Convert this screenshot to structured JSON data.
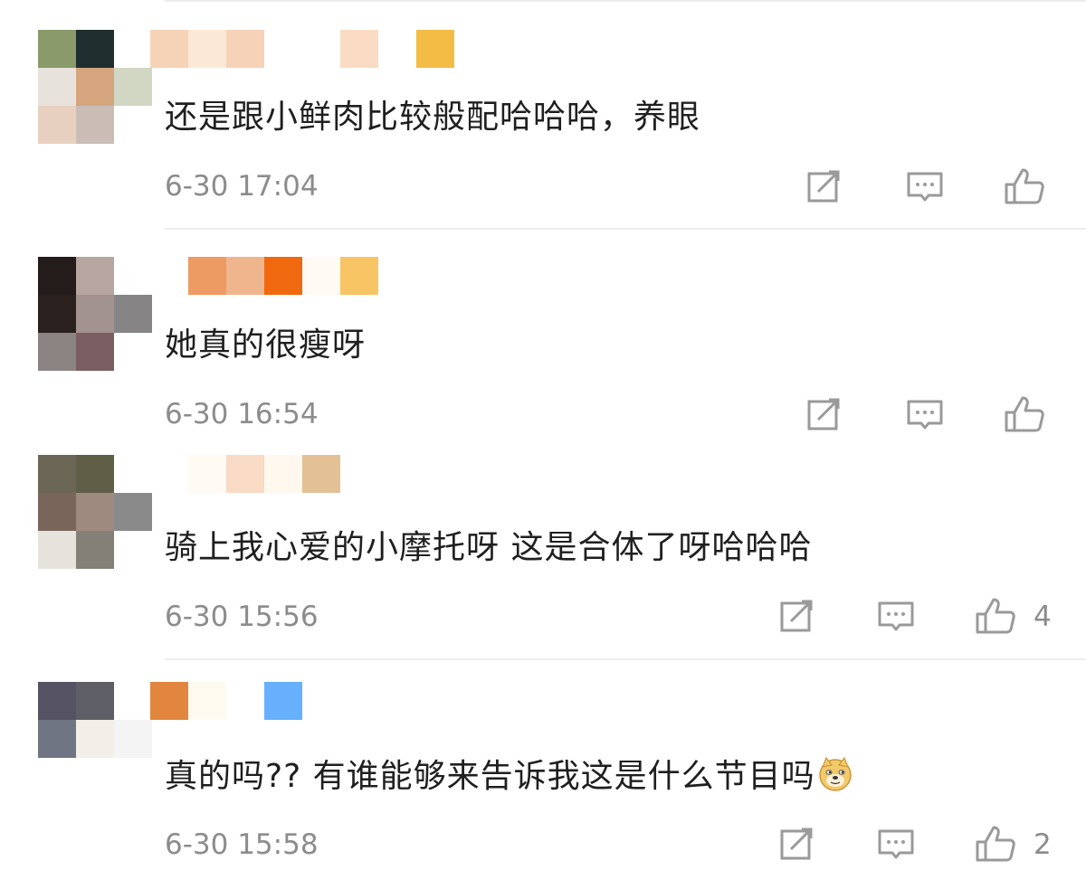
{
  "comments": [
    {
      "text": "还是跟小鲜肉比较般配哈哈哈，养眼",
      "time": "6-30 17:04",
      "likes": "",
      "has_emoji": false,
      "avatar_colors": [
        "#8a9a6a",
        "#1f2e2e",
        "#ffffff",
        "#e8e2dc",
        "#d5a57e",
        "#d2d7c3",
        "#e8d0c0",
        "#c9bdb6",
        "#ffffff"
      ],
      "name_colors": [
        "#f6d3b6",
        "#fbe8d6",
        "#f6d2b8",
        "#ffffff",
        "#ffffff",
        "#f9dcc3",
        "#ffffff",
        "#f3bc45"
      ]
    },
    {
      "text": "她真的很瘦呀",
      "time": "6-30 16:54",
      "likes": "",
      "has_emoji": false,
      "avatar_colors": [
        "#231c1b",
        "#b7a5a2",
        "#ffffff",
        "#2a211f",
        "#a29391",
        "#868485",
        "#8c8383",
        "#7a5e62",
        "#ffffff"
      ],
      "name_colors": [
        "#ffffff",
        "#ee9b63",
        "#efb58d",
        "#f0690e",
        "#fffaf4",
        "#f8c565",
        "#ffffff",
        "#ffffff"
      ]
    },
    {
      "text": "骑上我心爱的小摩托呀 这是合体了呀哈哈哈",
      "time": "6-30 15:56",
      "likes": "4",
      "has_emoji": false,
      "avatar_colors": [
        "#6c6657",
        "#5f5f48",
        "#ffffff",
        "#79655a",
        "#9f8a80",
        "#8a8a8a",
        "#e6e3dc",
        "#858077",
        "#ffffff"
      ],
      "name_colors": [
        "#ffffff",
        "#fffaf3",
        "#f9dac5",
        "#fff8ee",
        "#e3c194",
        "#ffffff",
        "#ffffff",
        "#ffffff"
      ]
    },
    {
      "text": "真的吗?? 有谁能够来告诉我这是什么节目吗",
      "time": "6-30 15:58",
      "likes": "2",
      "has_emoji": true,
      "avatar_colors": [
        "#555363",
        "#5e5e66",
        "#ffffff",
        "#6f7582",
        "#f2efe8",
        "#f4f4f4",
        "#ffffff",
        "#ffffff",
        "#ffffff"
      ],
      "name_colors": [
        "#e2863f",
        "#fffaf0",
        "#ffffff",
        "#66b0fd",
        "#ffffff",
        "#ffffff",
        "#ffffff",
        "#ffffff"
      ]
    }
  ],
  "icons": {
    "share": "share-icon",
    "reply": "comment-icon",
    "like": "thumbs-up-icon",
    "emoji": "doge-emoji-icon"
  },
  "colors": {
    "text": "#1f1f1f",
    "meta": "#8c8c8c",
    "icon": "#9a9a9a",
    "divider": "#ececec"
  }
}
